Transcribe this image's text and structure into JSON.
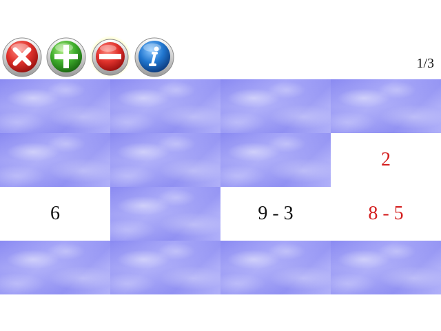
{
  "toolbar": {
    "buttons": [
      {
        "id": "close",
        "icon": "close-x-icon",
        "color": "#d8262a"
      },
      {
        "id": "add",
        "icon": "plus-icon",
        "color": "#3da22f"
      },
      {
        "id": "subtract",
        "icon": "minus-icon",
        "color": "#d8262a"
      },
      {
        "id": "info",
        "icon": "info-icon",
        "color": "#1f6fc8"
      }
    ]
  },
  "page_counter": "1/3",
  "colors": {
    "card_back": "#9a9af5",
    "text_default": "#111111",
    "text_highlight": "#d41f1f"
  },
  "board": {
    "cards": [
      {
        "state": "hidden",
        "text": ""
      },
      {
        "state": "hidden",
        "text": ""
      },
      {
        "state": "hidden",
        "text": ""
      },
      {
        "state": "hidden",
        "text": ""
      },
      {
        "state": "hidden",
        "text": ""
      },
      {
        "state": "hidden",
        "text": ""
      },
      {
        "state": "hidden",
        "text": ""
      },
      {
        "state": "open",
        "text": "2",
        "color": "#d41f1f"
      },
      {
        "state": "open",
        "text": "6",
        "color": "#111111"
      },
      {
        "state": "hidden",
        "text": ""
      },
      {
        "state": "open",
        "text": "9 - 3",
        "color": "#111111"
      },
      {
        "state": "open",
        "text": "8 - 5",
        "color": "#d41f1f"
      },
      {
        "state": "hidden",
        "text": ""
      },
      {
        "state": "hidden",
        "text": ""
      },
      {
        "state": "hidden",
        "text": ""
      },
      {
        "state": "hidden",
        "text": ""
      }
    ]
  }
}
